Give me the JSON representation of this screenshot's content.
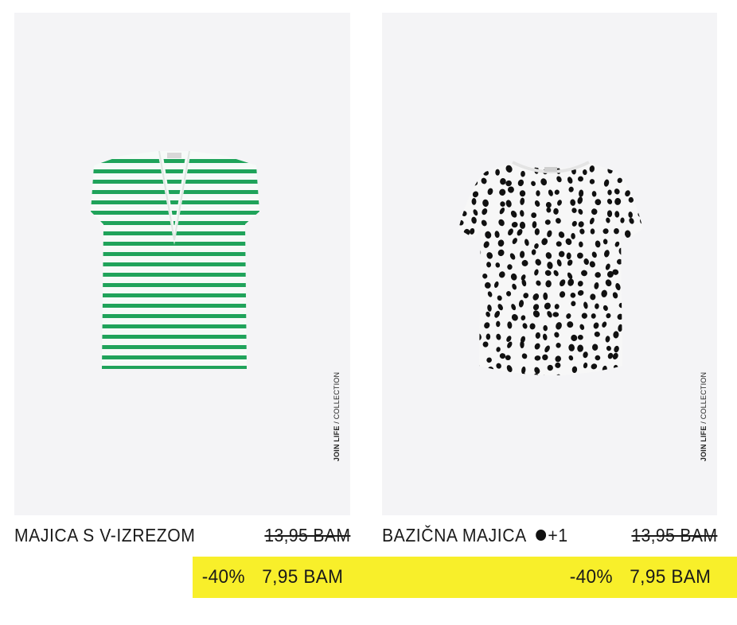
{
  "products": [
    {
      "name": "MAJICA S V-IZREZOM",
      "old_price": "13,95 BAM",
      "discount": "-40%",
      "new_price": "7,95 BAM",
      "badge_bold": "JOIN LIFE",
      "badge_rest": "/ COLLECTION",
      "stripe_color": "#1fa35a"
    },
    {
      "name": "BAZIČNA MAJICA",
      "extra_colors": "+1",
      "old_price": "13,95 BAM",
      "discount": "-40%",
      "new_price": "7,95 BAM",
      "badge_bold": "JOIN LIFE",
      "badge_rest": "/ COLLECTION",
      "dot_color": "#111111"
    }
  ],
  "colors": {
    "sale_background": "#f8ef2a",
    "photo_background": "#f4f4f6"
  }
}
